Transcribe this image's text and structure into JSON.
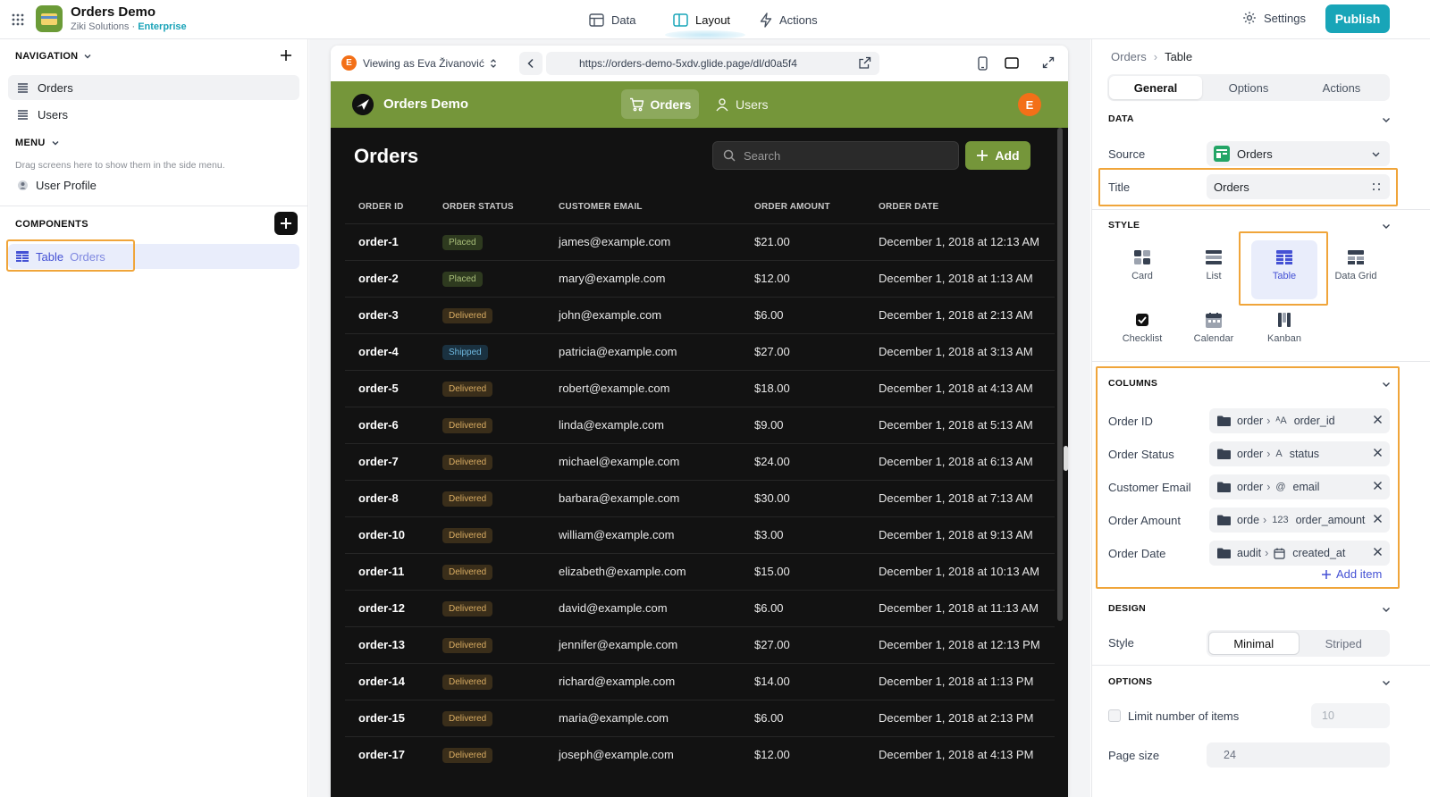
{
  "topbar": {
    "app_name": "Orders Demo",
    "org": "Ziki Solutions",
    "org_sep": " · ",
    "plan": "Enterprise",
    "nav": [
      {
        "label": "Data",
        "icon": "table-icon"
      },
      {
        "label": "Layout",
        "icon": "layout-icon",
        "active": true
      },
      {
        "label": "Actions",
        "icon": "bolt-icon"
      }
    ],
    "settings_label": "Settings",
    "publish_label": "Publish",
    "accent": "#18a5b8"
  },
  "left": {
    "navigation_title": "NAVIGATION",
    "nav_items": [
      {
        "label": "Orders",
        "active": true
      },
      {
        "label": "Users"
      }
    ],
    "menu_title": "MENU",
    "menu_hint": "Drag screens here to show them in the side menu.",
    "menu_items": [
      {
        "label": "User Profile"
      }
    ],
    "components_title": "COMPONENTS",
    "component": {
      "type": "Table",
      "name": "Orders"
    }
  },
  "device": {
    "viewing_as": "Viewing as Eva Živanović",
    "avatar_initial": "E",
    "url": "https://orders-demo-5xdv.glide.page/dl/d0a5f4"
  },
  "app": {
    "title": "Orders Demo",
    "tabs": [
      {
        "label": "Orders",
        "active": true
      },
      {
        "label": "Users"
      }
    ],
    "avatar_initial": "E",
    "header_color": "#75963a",
    "page_title": "Orders",
    "search_placeholder": "Search",
    "add_label": "Add",
    "columns": [
      "ORDER ID",
      "ORDER STATUS",
      "CUSTOMER EMAIL",
      "ORDER AMOUNT",
      "ORDER DATE"
    ],
    "rows": [
      {
        "id": "order-1",
        "status": "Placed",
        "email": "james@example.com",
        "amount": "$21.00",
        "date": "December 1, 2018 at 12:13 AM"
      },
      {
        "id": "order-2",
        "status": "Placed",
        "email": "mary@example.com",
        "amount": "$12.00",
        "date": "December 1, 2018 at 1:13 AM"
      },
      {
        "id": "order-3",
        "status": "Delivered",
        "email": "john@example.com",
        "amount": "$6.00",
        "date": "December 1, 2018 at 2:13 AM"
      },
      {
        "id": "order-4",
        "status": "Shipped",
        "email": "patricia@example.com",
        "amount": "$27.00",
        "date": "December 1, 2018 at 3:13 AM"
      },
      {
        "id": "order-5",
        "status": "Delivered",
        "email": "robert@example.com",
        "amount": "$18.00",
        "date": "December 1, 2018 at 4:13 AM"
      },
      {
        "id": "order-6",
        "status": "Delivered",
        "email": "linda@example.com",
        "amount": "$9.00",
        "date": "December 1, 2018 at 5:13 AM"
      },
      {
        "id": "order-7",
        "status": "Delivered",
        "email": "michael@example.com",
        "amount": "$24.00",
        "date": "December 1, 2018 at 6:13 AM"
      },
      {
        "id": "order-8",
        "status": "Delivered",
        "email": "barbara@example.com",
        "amount": "$30.00",
        "date": "December 1, 2018 at 7:13 AM"
      },
      {
        "id": "order-10",
        "status": "Delivered",
        "email": "william@example.com",
        "amount": "$3.00",
        "date": "December 1, 2018 at 9:13 AM"
      },
      {
        "id": "order-11",
        "status": "Delivered",
        "email": "elizabeth@example.com",
        "amount": "$15.00",
        "date": "December 1, 2018 at 10:13 AM"
      },
      {
        "id": "order-12",
        "status": "Delivered",
        "email": "david@example.com",
        "amount": "$6.00",
        "date": "December 1, 2018 at 11:13 AM"
      },
      {
        "id": "order-13",
        "status": "Delivered",
        "email": "jennifer@example.com",
        "amount": "$27.00",
        "date": "December 1, 2018 at 12:13 PM"
      },
      {
        "id": "order-14",
        "status": "Delivered",
        "email": "richard@example.com",
        "amount": "$14.00",
        "date": "December 1, 2018 at 1:13 PM"
      },
      {
        "id": "order-15",
        "status": "Delivered",
        "email": "maria@example.com",
        "amount": "$6.00",
        "date": "December 1, 2018 at 2:13 PM"
      },
      {
        "id": "order-17",
        "status": "Delivered",
        "email": "joseph@example.com",
        "amount": "$12.00",
        "date": "December 1, 2018 at 4:13 PM"
      }
    ]
  },
  "right": {
    "breadcrumb": [
      "Orders",
      "Table"
    ],
    "tabs": [
      {
        "label": "General",
        "active": true
      },
      {
        "label": "Options"
      },
      {
        "label": "Actions"
      }
    ],
    "data_title": "DATA",
    "source_label": "Source",
    "source_value": "Orders",
    "title_label": "Title",
    "title_value": "Orders",
    "style_title": "STYLE",
    "styles": [
      {
        "label": "Card",
        "icon": "card-icon"
      },
      {
        "label": "List",
        "icon": "list-icon"
      },
      {
        "label": "Table",
        "icon": "table-icon",
        "active": true
      },
      {
        "label": "Data Grid",
        "icon": "data-grid-icon"
      },
      {
        "label": "Checklist",
        "icon": "checklist-icon"
      },
      {
        "label": "Calendar",
        "icon": "calendar-icon"
      },
      {
        "label": "Kanban",
        "icon": "kanban-icon"
      }
    ],
    "columns_title": "COLUMNS",
    "columns": [
      {
        "label": "Order ID",
        "table": "order",
        "type": "text-type",
        "type_glyph": "ᴬA",
        "field": "order_id"
      },
      {
        "label": "Order Status",
        "table": "order",
        "type": "text-type",
        "type_glyph": "A",
        "field": "status"
      },
      {
        "label": "Customer Email",
        "table": "order",
        "type": "email-type",
        "type_glyph": "@",
        "field": "email"
      },
      {
        "label": "Order Amount",
        "table": "orde",
        "type": "number-type",
        "type_glyph": "123",
        "field": "order_amount"
      },
      {
        "label": "Order Date",
        "table": "audit",
        "type": "date-type",
        "type_glyph": "",
        "field": "created_at"
      }
    ],
    "add_item_label": "Add item",
    "design_title": "DESIGN",
    "design_style_label": "Style",
    "design_options": [
      {
        "label": "Minimal",
        "active": true
      },
      {
        "label": "Striped"
      }
    ],
    "options_title": "OPTIONS",
    "limit_label": "Limit number of items",
    "limit_placeholder": "10",
    "page_size_label": "Page size",
    "page_size_value": "24",
    "highlight_color": "#f0a53a"
  }
}
